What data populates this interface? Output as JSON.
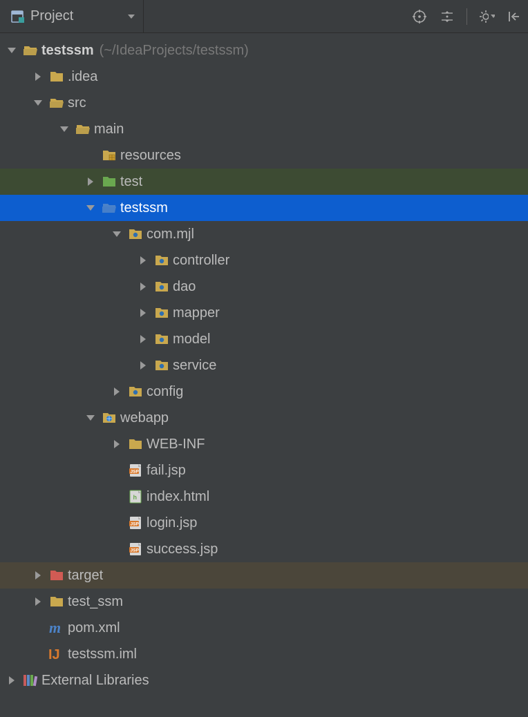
{
  "toolbar": {
    "view_label": "Project"
  },
  "tree": {
    "root": {
      "name": "testssm",
      "path": "(~/IdeaProjects/testssm)"
    },
    "idea": ".idea",
    "src": "src",
    "main": "main",
    "resources": "resources",
    "test": "test",
    "testssm_pkg": "testssm",
    "com_mjl": "com.mjl",
    "controller": "controller",
    "dao": "dao",
    "mapper": "mapper",
    "model": "model",
    "service": "service",
    "config": "config",
    "webapp": "webapp",
    "webinf": "WEB-INF",
    "fail_jsp": "fail.jsp",
    "index_html": "index.html",
    "login_jsp": "login.jsp",
    "success_jsp": "success.jsp",
    "target": "target",
    "test_ssm": "test_ssm",
    "pom": "pom.xml",
    "iml": "testssm.iml",
    "ext_lib": "External Libraries"
  }
}
